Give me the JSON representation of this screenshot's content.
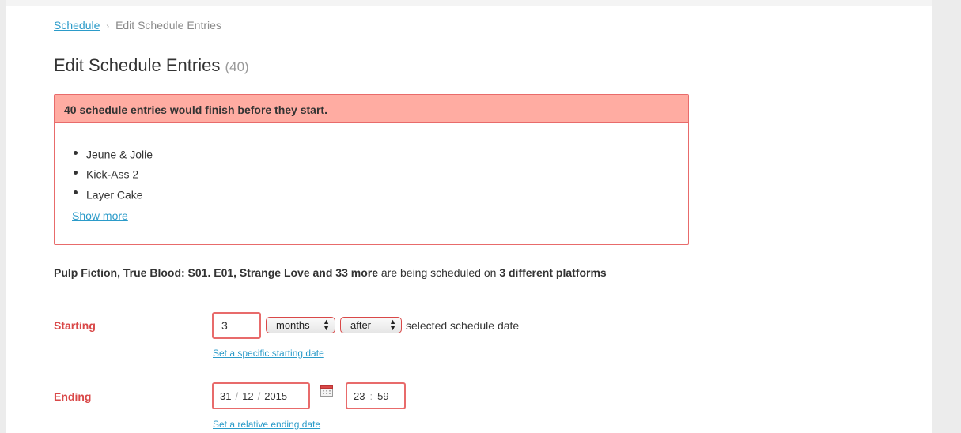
{
  "breadcrumb": {
    "root": "Schedule",
    "separator": "›",
    "current": "Edit Schedule Entries"
  },
  "page": {
    "title": "Edit Schedule Entries",
    "count": "(40)"
  },
  "alert": {
    "heading": "40 schedule entries would finish before they start.",
    "items": [
      "Jeune & Jolie",
      "Kick-Ass 2",
      "Layer Cake"
    ],
    "show_more": "Show more"
  },
  "summary": {
    "titles": "Pulp Fiction, True Blood: S01. E01, Strange Love and 33 more",
    "middle": "are being scheduled on",
    "platforms": "3 different platforms"
  },
  "starting": {
    "label": "Starting",
    "amount": "3",
    "unit": "months",
    "relation": "after",
    "suffix": "selected schedule date",
    "link": "Set a specific starting date"
  },
  "ending": {
    "label": "Ending",
    "day": "31",
    "month": "12",
    "year": "2015",
    "hour": "23",
    "minute": "59",
    "link": "Set a relative ending date"
  },
  "colors": {
    "link": "#2b9bc9",
    "error": "#d94848",
    "alert_bg": "#ffaca2",
    "border_error": "#e86b6b"
  },
  "icons": {
    "calendar": "calendar-icon",
    "select_arrows": "updown-arrows-icon"
  }
}
